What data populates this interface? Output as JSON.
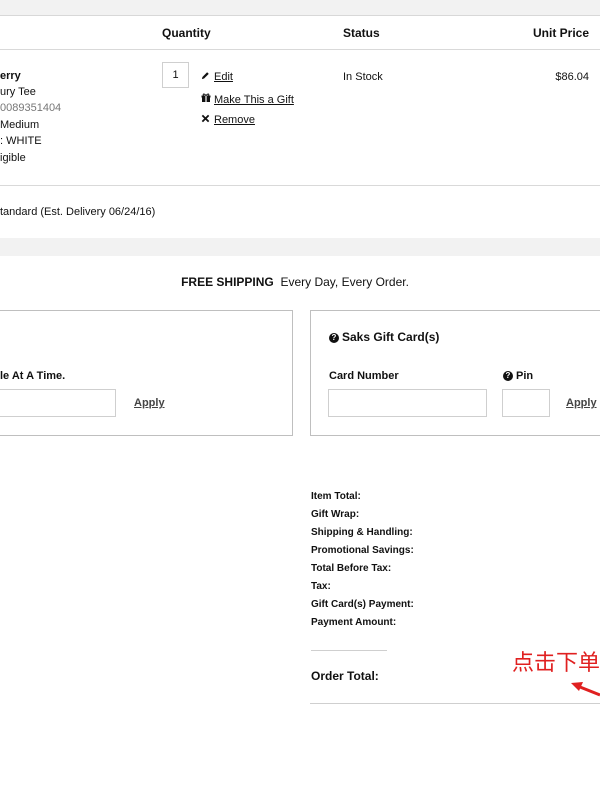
{
  "columns": {
    "quantity": "Quantity",
    "status": "Status",
    "unit_price": "Unit Price"
  },
  "item": {
    "line1": "erry",
    "line2": "ury Tee",
    "line3": "0089351404",
    "line4": "Medium",
    "line5": ": WHITE",
    "line6": "igible",
    "quantity": "1",
    "status": "In Stock",
    "price": "$86.04",
    "actions": {
      "edit": "Edit",
      "gift": "Make This a Gift",
      "remove": "Remove"
    },
    "shipping": "tandard (Est. Delivery 06/24/16)"
  },
  "banner": {
    "bold": "FREE SHIPPING",
    "rest": "Every Day, Every Order."
  },
  "promo": {
    "label": "le At A Time.",
    "apply": "Apply"
  },
  "giftcard": {
    "title": "Saks Gift Card(s)",
    "card_number_label": "Card Number",
    "pin_label": "Pin",
    "apply": "Apply"
  },
  "summary": {
    "item_total": "Item Total:",
    "gift_wrap": "Gift Wrap:",
    "shipping": "Shipping & Handling:",
    "promo_savings": "Promotional Savings:",
    "total_before_tax": "Total Before Tax:",
    "tax": "Tax:",
    "gift_card_payment": "Gift Card(s) Payment:",
    "payment_amount": "Payment Amount:",
    "order_total": "Order Total:"
  },
  "annotation": {
    "text": "点击下单",
    "color": "#e02020"
  },
  "icons": [
    "pencil-icon",
    "gift-icon",
    "close-icon",
    "question-icon",
    "arrow-icon"
  ]
}
